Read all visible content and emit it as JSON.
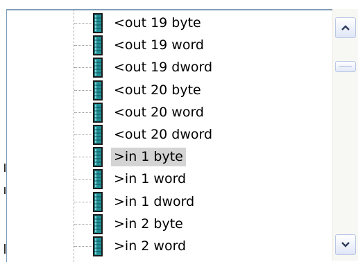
{
  "tree": {
    "items": [
      {
        "label": "<out 19 byte",
        "selected": false
      },
      {
        "label": "<out 19 word",
        "selected": false
      },
      {
        "label": "<out 19 dword",
        "selected": false
      },
      {
        "label": "<out 20 byte",
        "selected": false
      },
      {
        "label": "<out 20 word",
        "selected": false
      },
      {
        "label": "<out 20 dword",
        "selected": false
      },
      {
        "label": ">in 1 byte",
        "selected": true
      },
      {
        "label": ">in 1 word",
        "selected": false
      },
      {
        "label": ">in 1 dword",
        "selected": false
      },
      {
        "label": ">in 2 byte",
        "selected": false
      },
      {
        "label": ">in 2 word",
        "selected": false
      }
    ],
    "item_icon": "io-port-icon"
  },
  "scrollbar": {
    "up_icon": "chevron-up-icon",
    "down_icon": "chevron-down-icon"
  },
  "colors": {
    "selection": "#d4d4d4",
    "icon_teal": "#1f8f96",
    "icon_dark": "#1a1a1a",
    "scroll_border": "#b9c6e6",
    "panel_border": "#7f9db9"
  }
}
